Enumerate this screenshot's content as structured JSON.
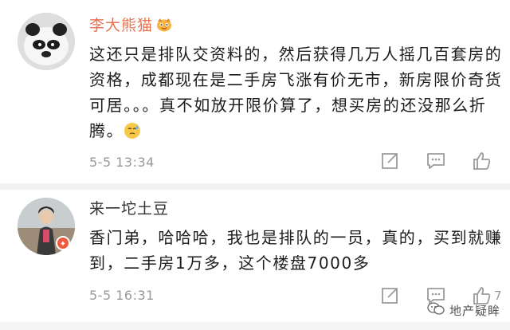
{
  "comments": [
    {
      "username": "李大熊猫",
      "text": "这还只是排队交资料的，然后获得几万人摇几百套房的资格，成都现在是二手房飞涨有价无市，新房限价奇货可居。。。真不如放开限价算了，想买房的还没那么折腾。",
      "emoji": "sweat-face",
      "timestamp": "5-5 13:34",
      "likes": ""
    },
    {
      "username": "来一坨土豆",
      "text": "香门弟，哈哈哈，我也是排队的一员，真的，买到就赚到，二手房1万多，这个楼盘7000多",
      "timestamp": "5-5 16:31",
      "likes": "7"
    }
  ],
  "watermark": "地产疑眸",
  "colors": {
    "username_accent": "#eb7350",
    "meta": "#999999"
  }
}
